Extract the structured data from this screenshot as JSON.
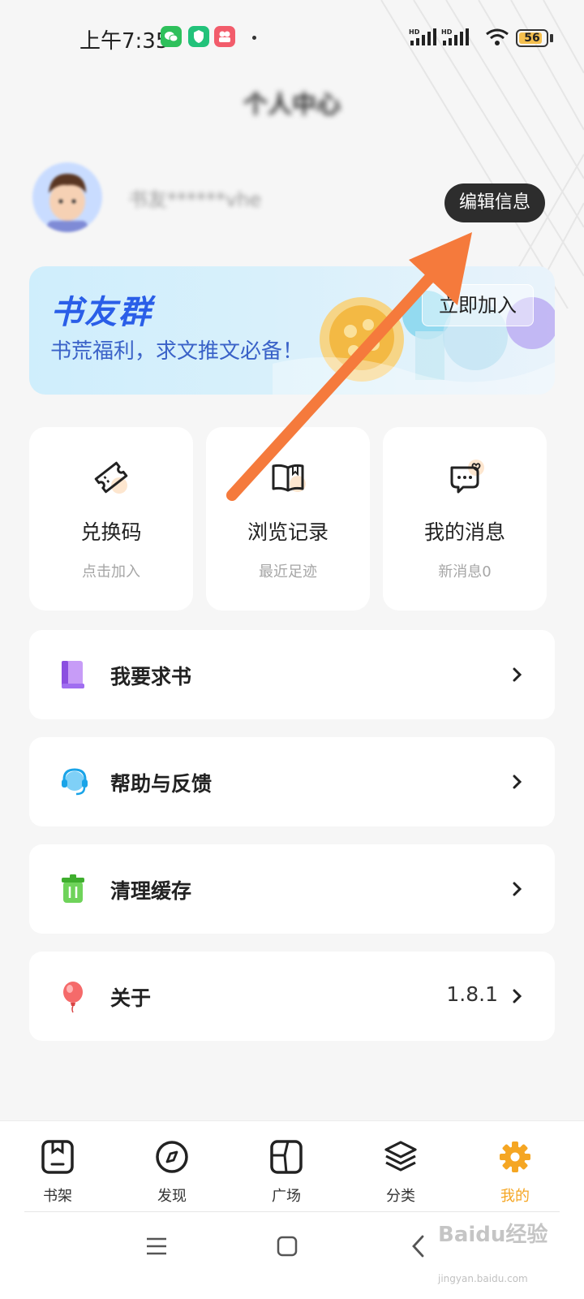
{
  "status_bar": {
    "time": "上午7:35",
    "signal1": "HD",
    "signal2": "HD",
    "battery": "56"
  },
  "header": {
    "title": "个人中心",
    "nickname": "书友******vhe",
    "edit_label": "编辑信息"
  },
  "banner": {
    "title": "书友群",
    "subtitle": "书荒福利，求文推文必备！",
    "join_label": "立即加入"
  },
  "cards": [
    {
      "title": "兑换码",
      "sub": "点击加入",
      "icon": "ticket-icon"
    },
    {
      "title": "浏览记录",
      "sub": "最近足迹",
      "icon": "book-icon"
    },
    {
      "title": "我的消息",
      "sub": "新消息0",
      "icon": "message-icon"
    }
  ],
  "menu": [
    {
      "label": "我要求书",
      "icon": "book-request-icon",
      "value": ""
    },
    {
      "label": "帮助与反馈",
      "icon": "headset-icon",
      "value": ""
    },
    {
      "label": "清理缓存",
      "icon": "trash-icon",
      "value": ""
    },
    {
      "label": "关于",
      "icon": "balloon-icon",
      "value": "1.8.1"
    }
  ],
  "tabs": [
    {
      "label": "书架",
      "icon": "bookshelf-icon",
      "active": false
    },
    {
      "label": "发现",
      "icon": "compass-icon",
      "active": false
    },
    {
      "label": "广场",
      "icon": "plaza-icon",
      "active": false
    },
    {
      "label": "分类",
      "icon": "layers-icon",
      "active": false
    },
    {
      "label": "我的",
      "icon": "gear-icon",
      "active": true
    }
  ],
  "watermark": {
    "text": "Baidu经验",
    "sub": "jingyan.baidu.com"
  },
  "colors": {
    "accent": "#f5a623",
    "arrow": "#f57a3c",
    "banner_title": "#2a5ee8"
  }
}
